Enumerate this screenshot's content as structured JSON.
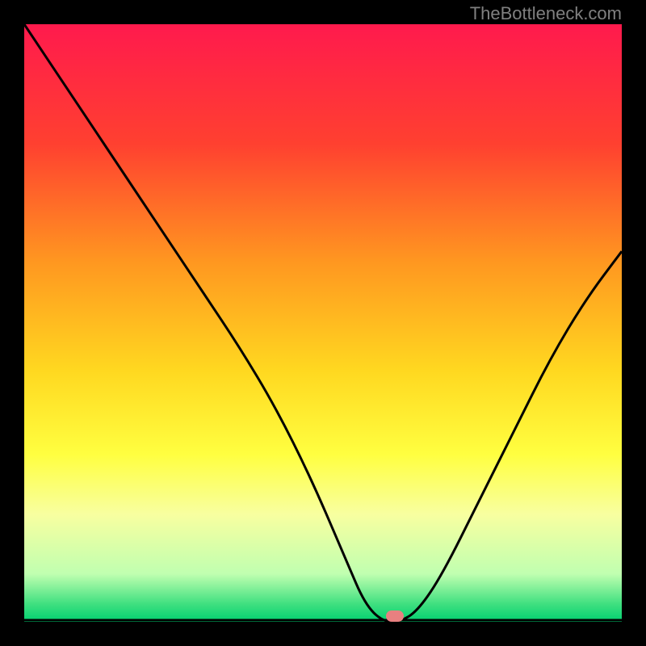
{
  "watermark": "TheBottleneck.com",
  "colors": {
    "black": "#000000",
    "marker": "#e88080",
    "curve": "#000000"
  },
  "marker": {
    "x_pct": 62,
    "y_pct": 99
  },
  "chart_data": {
    "type": "line",
    "title": "",
    "xlabel": "",
    "ylabel": "",
    "xlim": [
      0,
      100
    ],
    "ylim": [
      0,
      100
    ],
    "gradient_stops": [
      {
        "offset": 0,
        "color": "#ff1a4d"
      },
      {
        "offset": 20,
        "color": "#ff4030"
      },
      {
        "offset": 40,
        "color": "#ff9820"
      },
      {
        "offset": 58,
        "color": "#ffd820"
      },
      {
        "offset": 72,
        "color": "#ffff40"
      },
      {
        "offset": 82,
        "color": "#f8ffa0"
      },
      {
        "offset": 92,
        "color": "#c0ffb0"
      },
      {
        "offset": 97,
        "color": "#40e080"
      },
      {
        "offset": 100,
        "color": "#00d070"
      }
    ],
    "series": [
      {
        "name": "bottleneck-curve",
        "x": [
          0,
          8,
          16,
          24,
          30,
          36,
          42,
          48,
          54,
          57,
          60,
          63,
          66,
          70,
          76,
          82,
          88,
          94,
          100
        ],
        "y": [
          100,
          88,
          76,
          64,
          55,
          46,
          36,
          24,
          10,
          3,
          0,
          0,
          2,
          8,
          20,
          32,
          44,
          54,
          62
        ]
      }
    ],
    "optimal_point": {
      "x": 62,
      "y": 0
    }
  }
}
